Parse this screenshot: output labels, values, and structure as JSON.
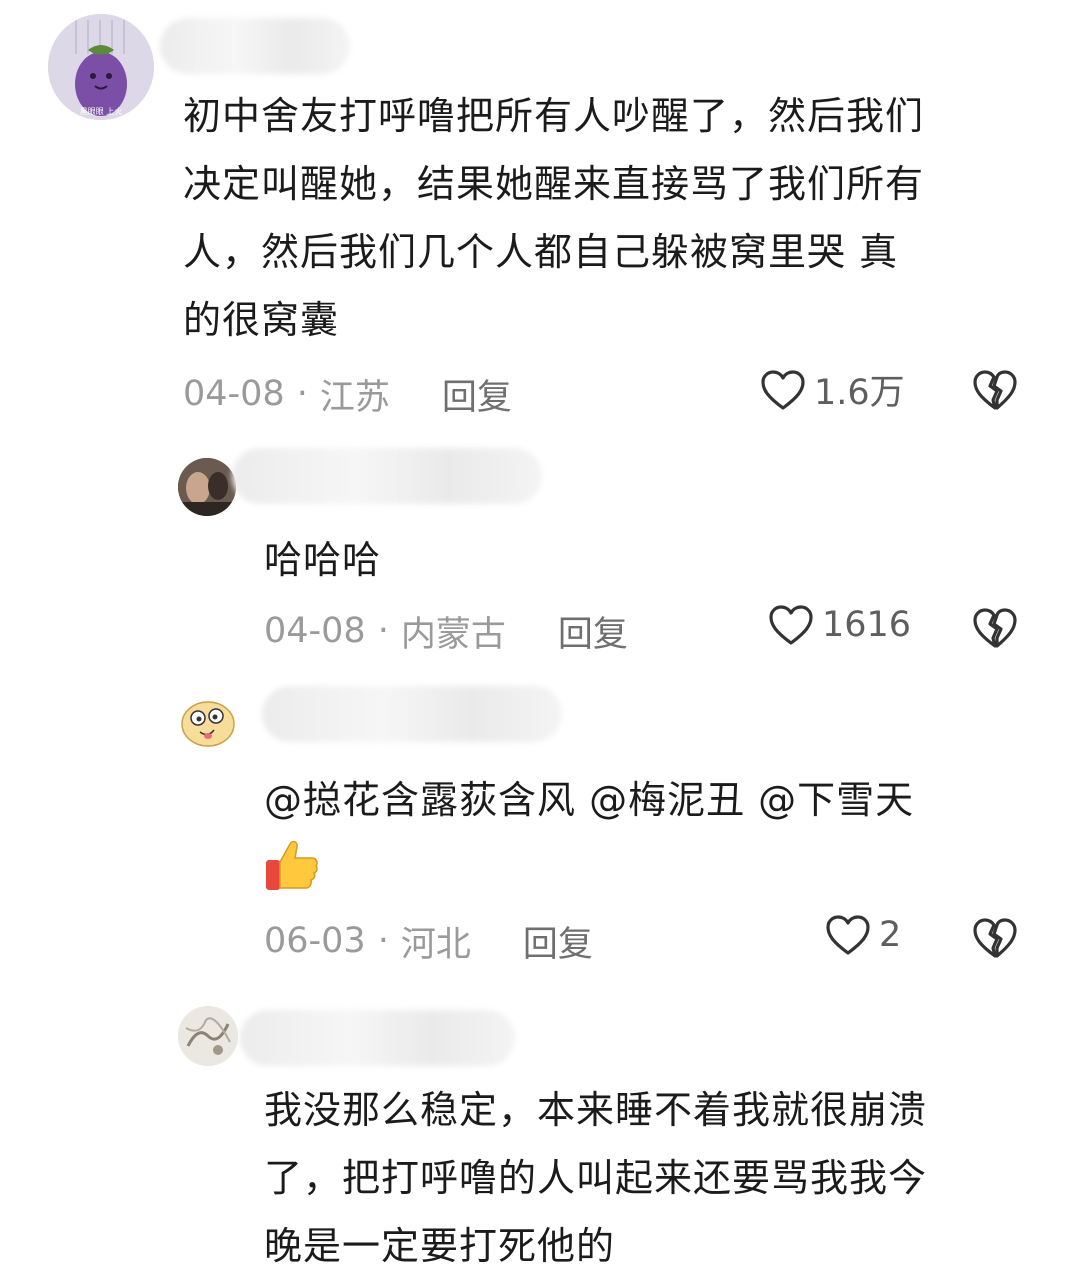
{
  "comments": [
    {
      "text": "初中舍友打呼噜把所有人吵醒了，然后我们决定叫醒她，结果她醒来直接骂了我们所有人，然后我们几个人都自己躲被窝里哭 真的很窝囊",
      "lines": [
        "初中舍友打呼噜把所有人吵醒了，然后我们",
        "决定叫醒她，结果她醒来直接骂了我们所有",
        "人，然后我们几个人都自己躲被窝里哭 真",
        "的很窝囊"
      ],
      "date": "04-08",
      "location": "江苏",
      "reply_label": "回复",
      "likes": "1.6万",
      "avatar_text": "黑眼眼  上火"
    },
    {
      "text": "哈哈哈",
      "lines": [
        "哈哈哈"
      ],
      "date": "04-08",
      "location": "内蒙古",
      "reply_label": "回复",
      "likes": "1616"
    },
    {
      "text": "@搃花含露荻含风 @梅泥丑 @下雪天",
      "lines": [
        "@搃花含露荻含风 @梅泥丑 @下雪天"
      ],
      "date": "06-03",
      "location": "河北",
      "reply_label": "回复",
      "likes": "2",
      "emoji": "thumbs-up"
    },
    {
      "text": "我没那么稳定，本来睡不着我就很崩溃了，把打呼噜的人叫起来还要骂我我今晚是一定要打死他的",
      "lines": [
        "我没那么稳定，本来睡不着我就很崩溃",
        "了，把打呼噜的人叫起来还要骂我我今",
        "晚是一定要打死他的"
      ]
    }
  ],
  "meta_separator": "·",
  "icons": {
    "like": "heart-outline-icon",
    "dislike": "broken-heart-icon"
  }
}
